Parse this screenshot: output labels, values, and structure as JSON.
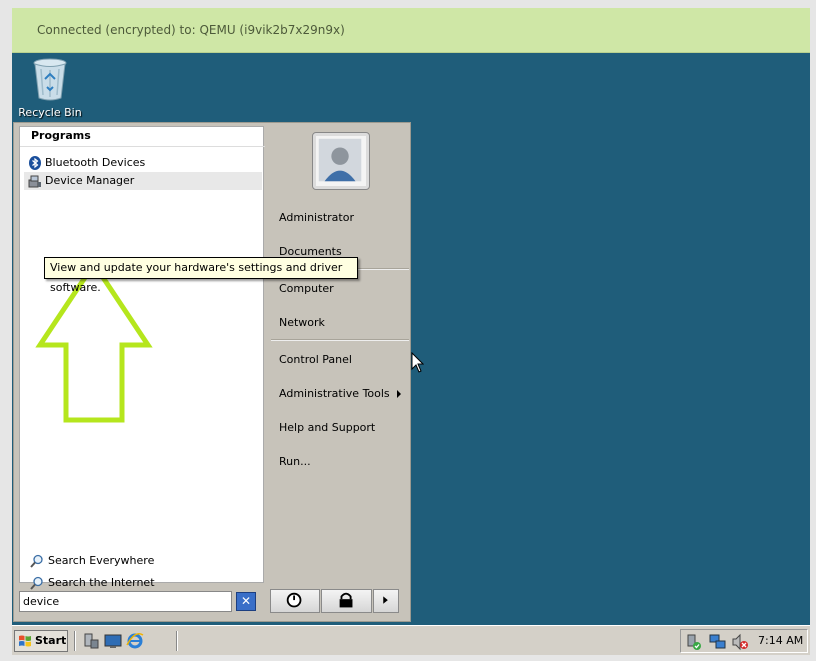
{
  "connection": {
    "text": "Connected (encrypted) to: QEMU (i9vik2b7x29n9x)"
  },
  "desktop": {
    "background": "#1f5d7a",
    "icons": [
      {
        "label": "Recycle Bin",
        "icon": "recycle-bin-icon"
      }
    ]
  },
  "start_menu": {
    "programs_header": "Programs",
    "programs": [
      {
        "label": "Bluetooth Devices",
        "icon": "bluetooth-icon"
      },
      {
        "label": "Device Manager",
        "icon": "device-manager-icon"
      }
    ],
    "tooltip": "View and update your hardware's settings and driver software.",
    "search_links": [
      {
        "label": "Search Everywhere",
        "icon": "search-icon"
      },
      {
        "label": "Search the Internet",
        "icon": "search-icon"
      }
    ],
    "search_value": "device",
    "right_items": [
      {
        "label": "Administrator"
      },
      {
        "label": "Documents"
      },
      {
        "label": "Computer"
      },
      {
        "label": "Network"
      },
      {
        "label": "Control Panel"
      },
      {
        "label": "Administrative Tools",
        "submenu": true
      },
      {
        "label": "Help and Support"
      },
      {
        "label": "Run..."
      }
    ]
  },
  "taskbar": {
    "start_label": "Start",
    "clock": "7:14 AM"
  },
  "colors": {
    "connection_bar": "#cfe7a6",
    "highlight_arrow": "#b5e61d",
    "tooltip_bg": "#ffffe1"
  }
}
